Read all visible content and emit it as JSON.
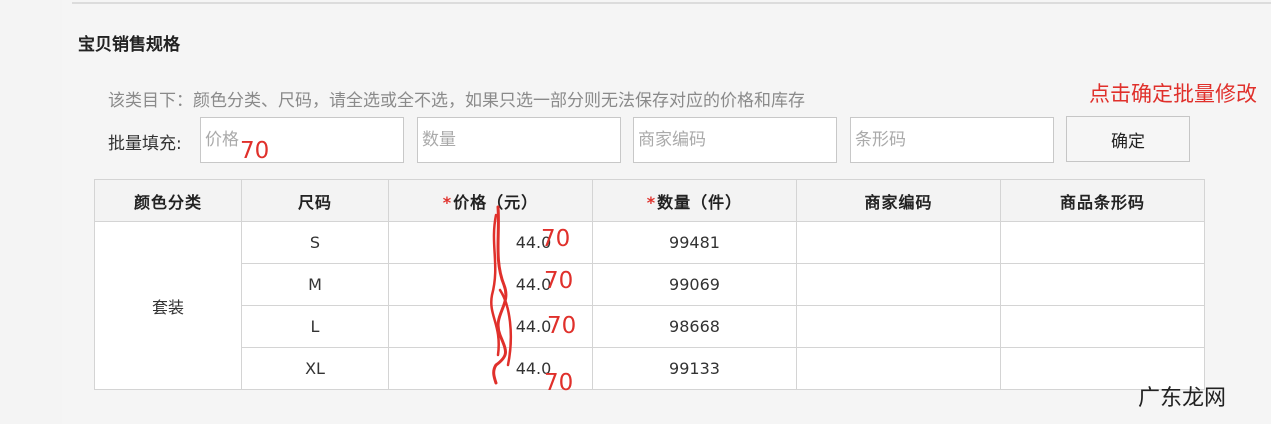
{
  "section_title": "宝贝销售规格",
  "note": "该类目下：颜色分类、尺码，请全选或全不选，如果只选一部分则无法保存对应的价格和库存",
  "red_hint": "点击确定批量修改",
  "batch": {
    "label": "批量填充:",
    "price_placeholder": "价格",
    "qty_placeholder": "数量",
    "merchant_code_placeholder": "商家编码",
    "barcode_placeholder": "条形码",
    "confirm_label": "确定"
  },
  "table": {
    "headers": {
      "color": "颜色分类",
      "size": "尺码",
      "price_star": "*",
      "price": "价格（元）",
      "qty_star": "*",
      "qty": "数量（件）",
      "merchant_code": "商家编码",
      "barcode": "商品条形码"
    },
    "color_value": "套装",
    "rows": [
      {
        "size": "S",
        "price": "44.0",
        "qty": "99481",
        "merchant_code": "",
        "barcode": ""
      },
      {
        "size": "M",
        "price": "44.0",
        "qty": "99069",
        "merchant_code": "",
        "barcode": ""
      },
      {
        "size": "L",
        "price": "44.0",
        "qty": "98668",
        "merchant_code": "",
        "barcode": ""
      },
      {
        "size": "XL",
        "price": "44.0",
        "qty": "99133",
        "merchant_code": "",
        "barcode": ""
      }
    ]
  },
  "handwritten": {
    "batch_price": "70",
    "row1": "70",
    "row2": "70",
    "row3": "70",
    "row4": "70"
  },
  "colors": {
    "annotation_red": "#e0302b"
  },
  "watermark": "广东龙网"
}
